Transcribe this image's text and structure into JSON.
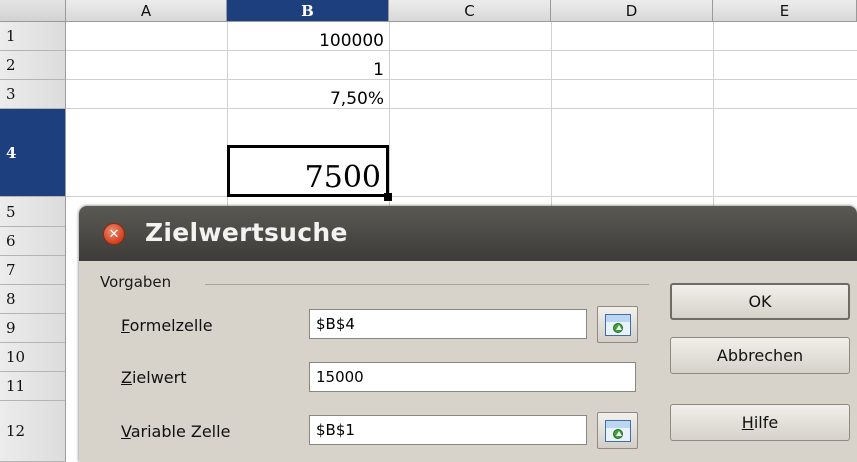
{
  "sheet": {
    "columns": [
      "A",
      "B",
      "C",
      "D",
      "E"
    ],
    "rows": [
      "1",
      "2",
      "3",
      "4",
      "5",
      "6",
      "7",
      "8",
      "9",
      "10",
      "11",
      "12"
    ],
    "selected_column": "B",
    "selected_row": "4",
    "cells": {
      "B1": "100000",
      "B2": "1",
      "B3": "7,50%",
      "B4": "7500"
    }
  },
  "dialog": {
    "title": "Zielwertsuche",
    "group_label": "Vorgaben",
    "fields": {
      "formelzelle": {
        "label_mnemonic": "F",
        "label_rest": "ormelzelle",
        "value": "$B$4"
      },
      "zielwert": {
        "label_mnemonic": "Z",
        "label_rest": "ielwert",
        "value": "15000"
      },
      "variable_zelle": {
        "label_mnemonic": "V",
        "label_rest": "ariable Zelle",
        "value": "$B$1"
      }
    },
    "buttons": {
      "ok": "OK",
      "cancel": "Abbrechen",
      "help_mnemonic": "H",
      "help_rest": "ilfe"
    },
    "icons": {
      "close": "close-icon",
      "shrink": "shrink-dialog-icon"
    },
    "colors": {
      "title_bar": "#45443f",
      "dialog_bg": "#d7d3cb",
      "selection_header": "#1d3f7d",
      "close_button": "#d2411f"
    }
  }
}
